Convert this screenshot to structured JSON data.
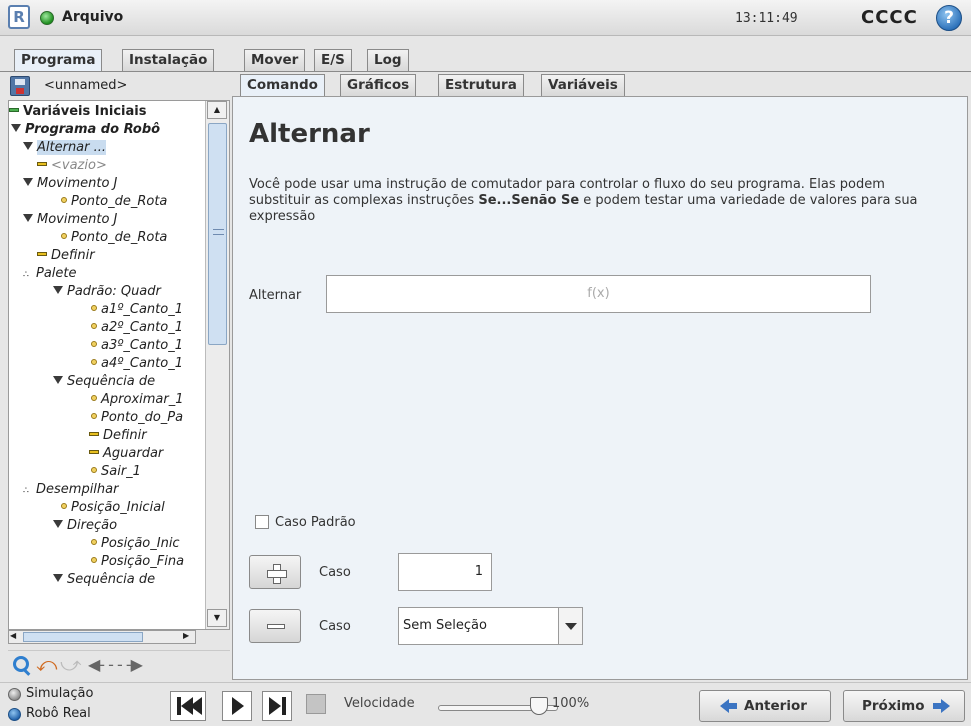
{
  "header": {
    "app_title": "Arquivo",
    "clock": "13:11:49",
    "robot_name": "CCCC",
    "help_symbol": "?",
    "logo_letter": "R"
  },
  "main_tabs": [
    {
      "label": "Programa",
      "active": true
    },
    {
      "label": "Instalação",
      "active": false
    },
    {
      "label": "Mover",
      "active": false
    },
    {
      "label": "E/S",
      "active": false
    },
    {
      "label": "Log",
      "active": false
    }
  ],
  "file": {
    "name": "<unnamed>"
  },
  "tree": [
    {
      "label": "Variáveis Iniciais",
      "icon": "green-bar-icon"
    },
    {
      "label": "Programa do Robô",
      "icon": "expand-triangle-icon"
    },
    {
      "label": "Alternar ...",
      "icon": "expand-triangle-icon",
      "selected": true
    },
    {
      "label": "<vazio>",
      "icon": "yellow-bar-icon"
    },
    {
      "label": "Movimento J",
      "icon": "expand-triangle-icon"
    },
    {
      "label": "Ponto_de_Rota",
      "icon": "waypoint-dot-icon"
    },
    {
      "label": "Movimento J",
      "icon": "expand-triangle-icon"
    },
    {
      "label": "Ponto_de_Rota",
      "icon": "waypoint-dot-icon"
    },
    {
      "label": "Definir",
      "icon": "yellow-bar-icon"
    },
    {
      "label": "Palete",
      "icon": "pallet-icon"
    },
    {
      "label": "Padrão: Quadr",
      "icon": "expand-triangle-icon"
    },
    {
      "label": "a1º_Canto_1",
      "icon": "waypoint-dot-icon"
    },
    {
      "label": "a2º_Canto_1",
      "icon": "waypoint-dot-icon"
    },
    {
      "label": "a3º_Canto_1",
      "icon": "waypoint-dot-icon"
    },
    {
      "label": "a4º_Canto_1",
      "icon": "waypoint-dot-icon"
    },
    {
      "label": "Sequência de",
      "icon": "expand-triangle-icon"
    },
    {
      "label": "Aproximar_1",
      "icon": "waypoint-dot-icon"
    },
    {
      "label": "Ponto_do_Pa",
      "icon": "waypoint-dot-icon"
    },
    {
      "label": "Definir",
      "icon": "yellow-bar-icon"
    },
    {
      "label": "Aguardar",
      "icon": "yellow-bar-icon"
    },
    {
      "label": "Sair_1",
      "icon": "waypoint-dot-icon"
    },
    {
      "label": "Desempilhar",
      "icon": "pallet-icon"
    },
    {
      "label": "Posição_Inicial",
      "icon": "waypoint-dot-icon"
    },
    {
      "label": "Direção",
      "icon": "expand-triangle-icon"
    },
    {
      "label": "Posição_Inic",
      "icon": "waypoint-dot-icon"
    },
    {
      "label": "Posição_Fina",
      "icon": "waypoint-dot-icon"
    },
    {
      "label": "Sequência de",
      "icon": "expand-triangle-icon"
    }
  ],
  "content_tabs": [
    {
      "label": "Comando",
      "active": true
    },
    {
      "label": "Gráficos",
      "active": false
    },
    {
      "label": "Estrutura",
      "active": false
    },
    {
      "label": "Variáveis",
      "active": false
    }
  ],
  "command": {
    "title": "Alternar",
    "description_1": "Você pode usar uma instrução de comutador para controlar o fluxo do seu programa. Elas podem substituir as complexas instruções ",
    "description_bold": "Se...Senão Se",
    "description_2": " e podem testar uma variedade de valores para sua expressão",
    "switch_label": "Alternar",
    "expression_placeholder": "f(x)",
    "default_case_label": "Caso Padrão",
    "add_case_label": "Caso",
    "case_value": "1",
    "remove_case_label": "Caso",
    "case_select_value": "Sem Seleção"
  },
  "footer": {
    "simulation_label": "Simulação",
    "real_robot_label": "Robô Real",
    "speed_label": "Velocidade",
    "speed_percent": "100%",
    "speed_value": 100,
    "prev_label": "Anterior",
    "next_label": "Próximo"
  }
}
